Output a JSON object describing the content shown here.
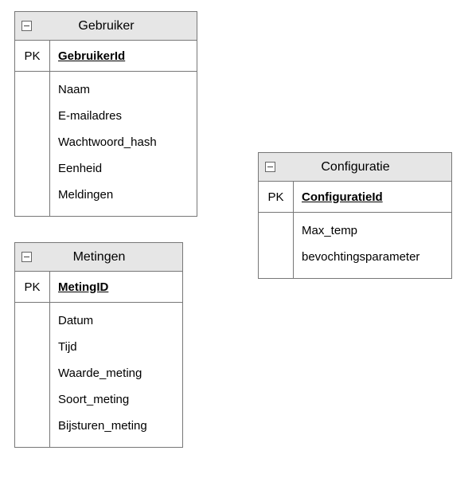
{
  "entities": {
    "gebruiker": {
      "title": "Gebruiker",
      "pk_label": "PK",
      "pk_field": "GebruikerId",
      "attrs": [
        "Naam",
        "E-mailadres",
        "Wachtwoord_hash",
        "Eenheid",
        "Meldingen"
      ]
    },
    "metingen": {
      "title": "Metingen",
      "pk_label": "PK",
      "pk_field": "MetingID",
      "attrs": [
        "Datum",
        "Tijd",
        "Waarde_meting",
        "Soort_meting",
        "Bijsturen_meting"
      ]
    },
    "configuratie": {
      "title": "Configuratie",
      "pk_label": "PK",
      "pk_field": "ConfiguratieId",
      "attrs": [
        "Max_temp",
        "bevochtingsparameter"
      ]
    }
  }
}
